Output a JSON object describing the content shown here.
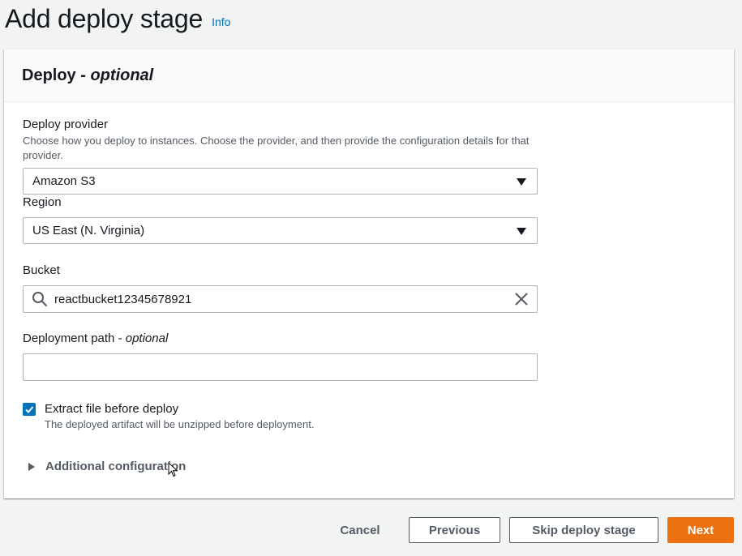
{
  "header": {
    "title": "Add deploy stage",
    "info_link": "Info"
  },
  "panel": {
    "title": "Deploy",
    "title_suffix": "optional"
  },
  "deploy_provider": {
    "label": "Deploy provider",
    "description": "Choose how you deploy to instances. Choose the provider, and then provide the configuration details for that provider.",
    "value": "Amazon S3"
  },
  "region": {
    "label": "Region",
    "value": "US East (N. Virginia)"
  },
  "bucket": {
    "label": "Bucket",
    "value": "reactbucket12345678921"
  },
  "deployment_path": {
    "label": "Deployment path",
    "label_suffix": "optional",
    "value": ""
  },
  "extract": {
    "label": "Extract file before deploy",
    "description": "The deployed artifact will be unzipped before deployment.",
    "checked": true
  },
  "additional_configuration": {
    "label": "Additional configuration"
  },
  "footer": {
    "cancel": "Cancel",
    "previous": "Previous",
    "skip": "Skip deploy stage",
    "next": "Next"
  },
  "colors": {
    "primary_button": "#ec7211",
    "link": "#0073bb",
    "checkbox": "#0073bb"
  }
}
